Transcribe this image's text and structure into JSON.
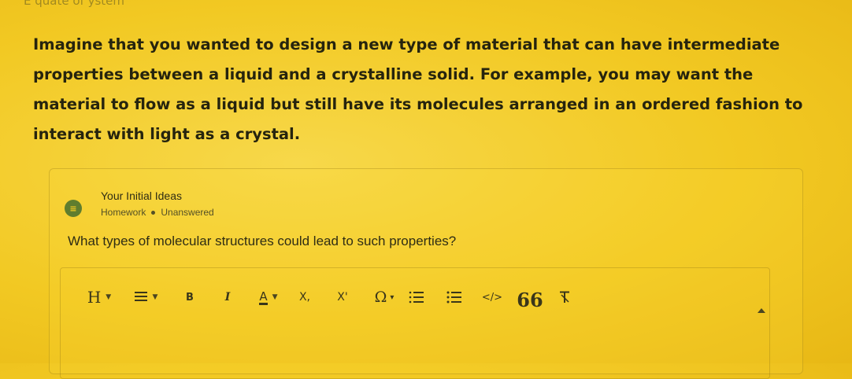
{
  "top_fragment": "E   quate of ystem",
  "intro_text": "Imagine that you wanted to design a new type of material that can have intermediate properties between a liquid and a crystalline solid. For example, you may want the material to flow as a liquid but still have its molecules arranged in an ordered fashion to interact with light as a crystal.",
  "assignment": {
    "title": "Your Initial Ideas",
    "type": "Homework",
    "status": "Unanswered",
    "icon": "list-icon"
  },
  "question": "What types of molecular structures could lead to such properties?",
  "toolbar": {
    "heading": "H",
    "bold": "B",
    "italic": "I",
    "font_color": "A",
    "subscript": "X,",
    "superscript": "X'",
    "special_char": "Ω",
    "code": "</>",
    "quote": "66",
    "clear_format": "T"
  },
  "colors": {
    "background": "#f2c923",
    "text": "#26240e",
    "icon_green": "#5f7d2e"
  }
}
